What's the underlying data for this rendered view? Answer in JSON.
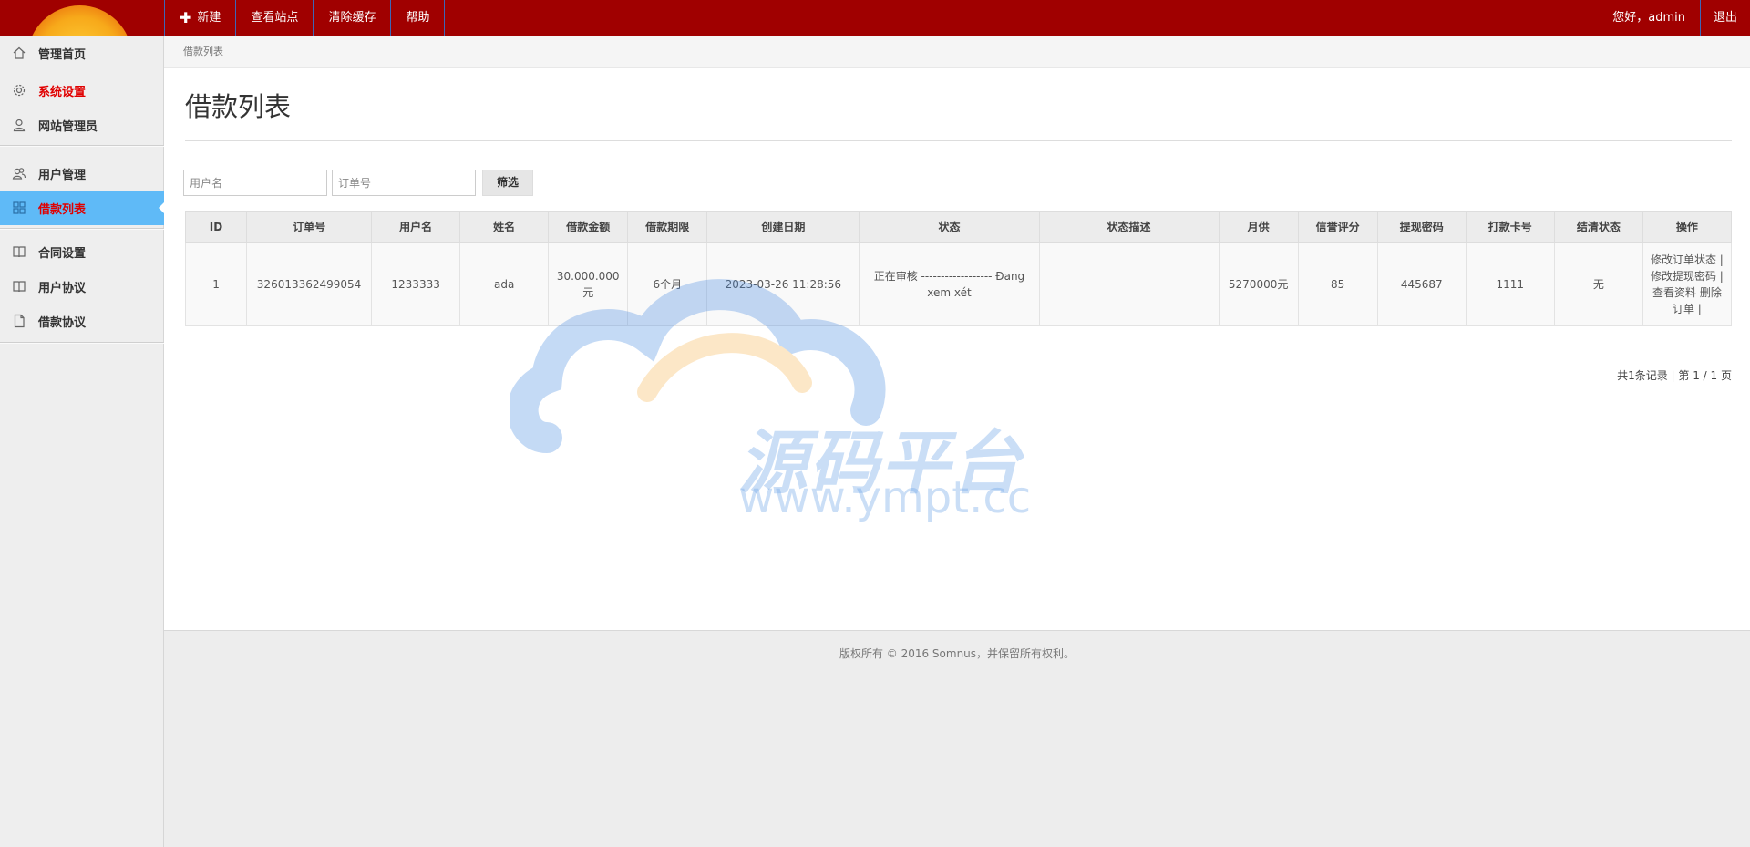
{
  "topnav": {
    "items": [
      {
        "label": "新建",
        "icon": "plus-icon"
      },
      {
        "label": "查看站点"
      },
      {
        "label": "清除缓存"
      },
      {
        "label": "帮助"
      }
    ],
    "greeting": "您好，admin",
    "logout": "退出"
  },
  "sidebar": {
    "items": [
      {
        "label": "管理首页",
        "icon": "home-icon"
      },
      {
        "label": "系统设置",
        "icon": "gear-icon"
      },
      {
        "label": "网站管理员",
        "icon": "user-icon"
      },
      {
        "label": "用户管理",
        "icon": "users-icon"
      },
      {
        "label": "借款列表",
        "icon": "grid-icon"
      },
      {
        "label": "合同设置",
        "icon": "book-icon"
      },
      {
        "label": "用户协议",
        "icon": "book-icon"
      },
      {
        "label": "借款协议",
        "icon": "file-icon"
      }
    ]
  },
  "breadcrumb": "借款列表",
  "page_title": "借款列表",
  "filter": {
    "username_placeholder": "用户名",
    "order_placeholder": "订单号",
    "button": "筛选"
  },
  "table": {
    "headers": [
      "ID",
      "订单号",
      "用户名",
      "姓名",
      "借款金额",
      "借款期限",
      "创建日期",
      "状态",
      "状态描述",
      "月供",
      "信誉评分",
      "提现密码",
      "打款卡号",
      "结清状态",
      "操作"
    ],
    "rows": [
      {
        "id": "1",
        "order_no": "326013362499054",
        "username": "1233333",
        "name": "ada",
        "amount": "30.000.000元",
        "term": "6个月",
        "created": "2023-03-26 11:28:56",
        "status": "正在审核 ------------------ Đang xem xét",
        "status_desc": "",
        "monthly": "5270000元",
        "credit": "85",
        "withdraw_pwd": "445687",
        "card_no": "1111",
        "settled": "无",
        "ops": [
          "修改订单状态 |",
          "修改提现密码 |",
          "查看资料",
          "删除订单 |"
        ]
      }
    ]
  },
  "pager": "共1条记录 | 第 1 / 1 页",
  "watermark": {
    "title": "源码平台",
    "url": "www.ympt.cc"
  },
  "footer": "版权所有 © 2016 Somnus，并保留所有权利。",
  "colors": {
    "topbar": "#a00000",
    "active_sidebar": "#5fbaf7",
    "alert_red": "#e00000"
  }
}
